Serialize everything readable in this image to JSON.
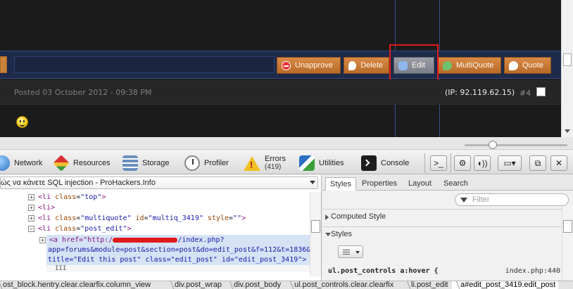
{
  "forum": {
    "buttons": [
      {
        "key": "unapprove",
        "label": "Unapprove",
        "icon": "unapprove-icon"
      },
      {
        "key": "delete",
        "label": "Delete",
        "icon": "delete-icon"
      },
      {
        "key": "edit",
        "label": "Edit",
        "icon": "edit-icon"
      },
      {
        "key": "multiquote",
        "label": "MultiQuote",
        "icon": "multiquote-icon"
      },
      {
        "key": "quote",
        "label": "Quote",
        "icon": "quote-icon"
      }
    ],
    "posted": "Posted 03 October 2012 - 09:38 PM",
    "ip": "(IP: 92.119.62.15)",
    "post_number": "#4",
    "highlight_color": "#e51a1a"
  },
  "devtools": {
    "toolbar": {
      "network": "Network",
      "resources": "Resources",
      "storage": "Storage",
      "profiler": "Profiler",
      "errors": "Errors",
      "errors_count": "(419)",
      "utilities": "Utilities",
      "console": "Console"
    },
    "document_select": "ώς να κάνετε SQL injection - ProHackers.Info",
    "dom": {
      "li_top": {
        "tag_open": "<li",
        "attr": "class",
        "val": "\"top\"",
        "tag_close": ">"
      },
      "li_plain": "<li>",
      "li_multiquote": {
        "tag_open": "<li",
        "attr1": "class",
        "val1": "\"multiquote\"",
        "attr2": "id",
        "val2": "\"multiq_3419\"",
        "attr3": "style",
        "val3": "\"\"",
        "tag_close": ">"
      },
      "li_post_edit": {
        "tag_open": "<li",
        "attr": "class",
        "val": "\"post_edit\"",
        "tag_close": ">"
      },
      "a_line1_pre": "<a href=\"http:/",
      "a_line1_post": "/index.php?",
      "a_line2": "app=forums&module=post&section=post&do=edit_post&f=112&t=1836&",
      "a_line3": "title=\"Edit this post\" class=\"edit_post\" id=\"edit_post_3419\">",
      "hscroll_grip": "III"
    },
    "side_tabs": [
      "Styles",
      "Properties",
      "Layout",
      "Search"
    ],
    "filter_placeholder": "Filter",
    "computed_style": "Computed Style",
    "styles": "Styles",
    "rule_selector": "ul.post_controls a:hover {",
    "rule_source": "index.php:440",
    "breadcrumbs": [
      "ost_block.hentry.clear.clearfix.column_view",
      "div.post_wrap",
      "div.post_body",
      "ul.post_controls.clear.clearfix",
      "li.post_edit",
      "a#edit_post_3419.edit_post"
    ]
  }
}
